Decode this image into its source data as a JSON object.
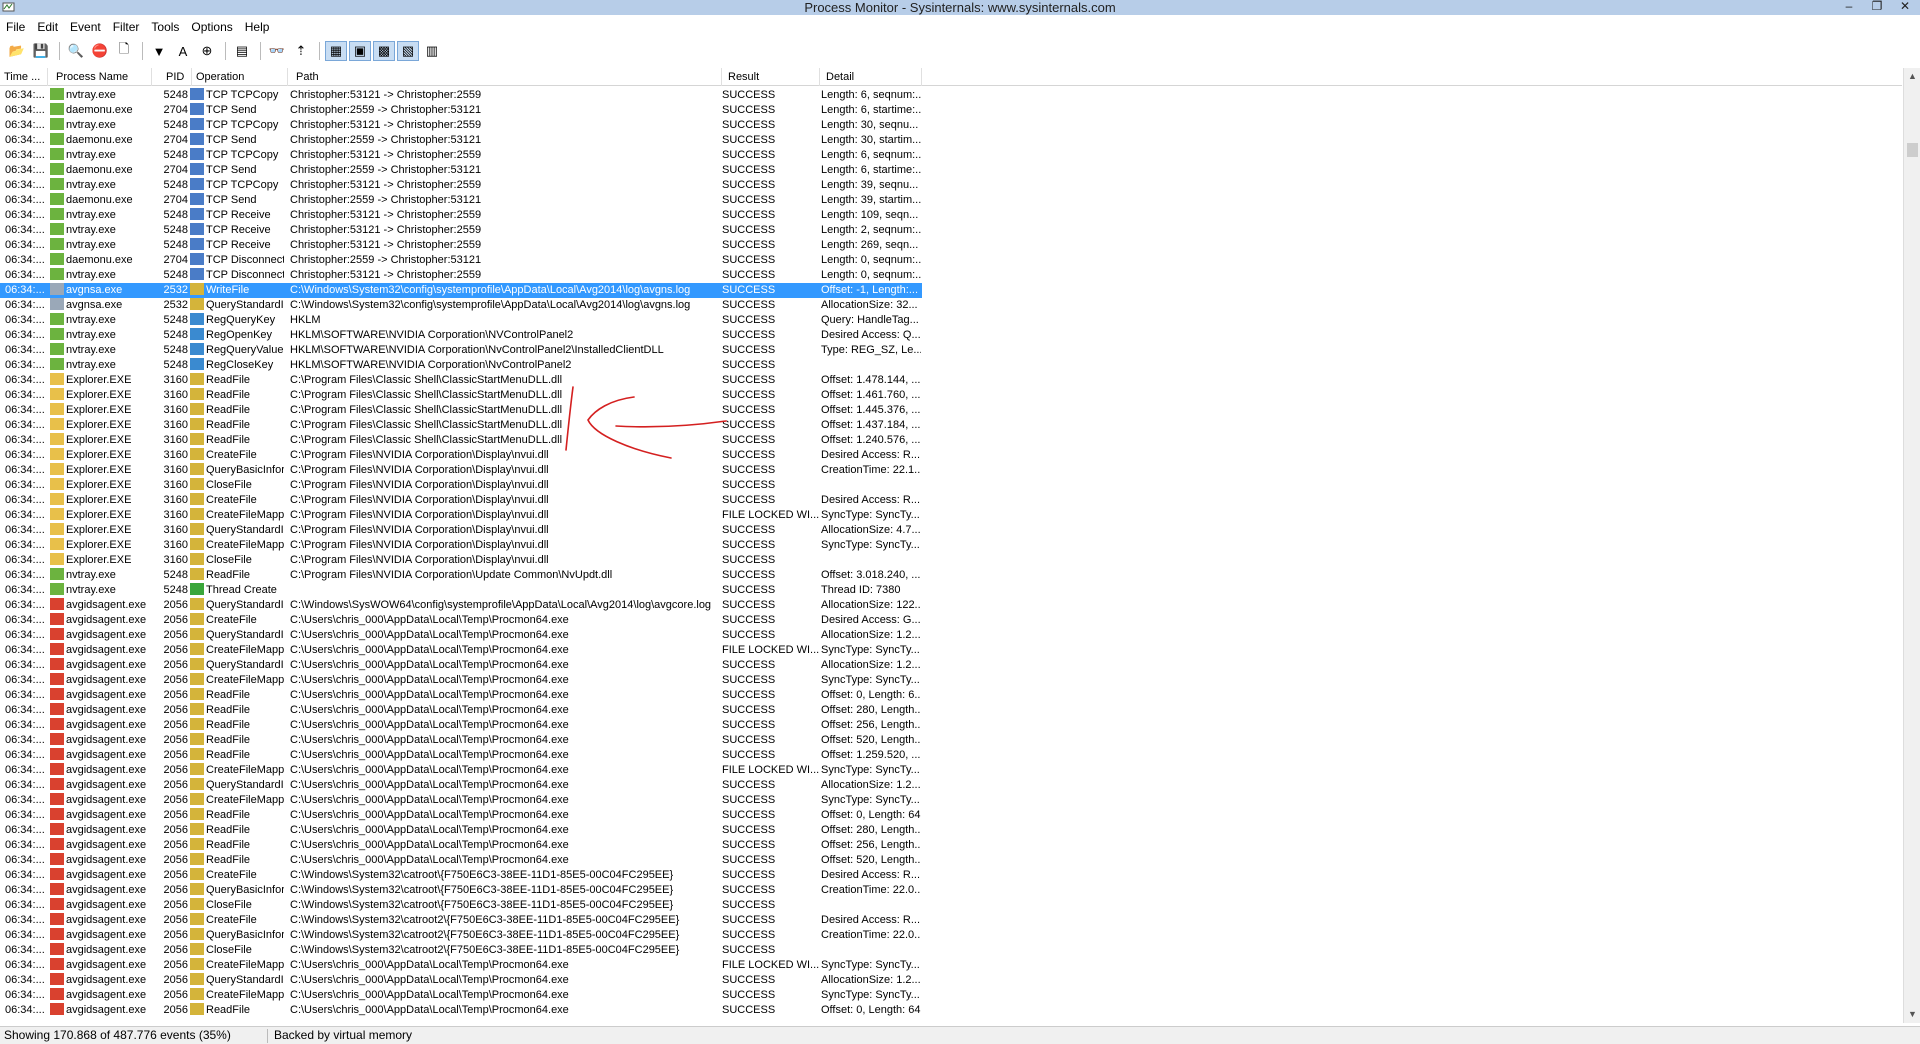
{
  "window": {
    "title": "Process Monitor - Sysinternals: www.sysinternals.com"
  },
  "menu": [
    "File",
    "Edit",
    "Event",
    "Filter",
    "Tools",
    "Options",
    "Help"
  ],
  "toolbar": {
    "buttons": [
      {
        "name": "open-icon",
        "glyph": "📂",
        "pressed": false
      },
      {
        "name": "save-icon",
        "glyph": "💾",
        "pressed": false
      },
      {
        "sep": true
      },
      {
        "name": "magnify-icon",
        "glyph": "🔍",
        "pressed": false
      },
      {
        "name": "autoscroll-icon",
        "glyph": "⛔",
        "pressed": false
      },
      {
        "name": "clear-icon",
        "glyph": "🗋",
        "pressed": false
      },
      {
        "sep": true
      },
      {
        "name": "filter-icon",
        "glyph": "▼",
        "pressed": false
      },
      {
        "name": "highlight-icon",
        "glyph": "A",
        "pressed": false
      },
      {
        "name": "include-process-icon",
        "glyph": "⊕",
        "pressed": false
      },
      {
        "sep": true
      },
      {
        "name": "process-tree-icon",
        "glyph": "▤",
        "pressed": false
      },
      {
        "sep": true
      },
      {
        "name": "find-icon",
        "glyph": "👓",
        "pressed": false
      },
      {
        "name": "jump-icon",
        "glyph": "⇡",
        "pressed": false
      },
      {
        "sep": true
      },
      {
        "name": "registry-activity-icon",
        "glyph": "▦",
        "pressed": true
      },
      {
        "name": "file-activity-icon",
        "glyph": "▣",
        "pressed": true
      },
      {
        "name": "network-activity-icon",
        "glyph": "▩",
        "pressed": true
      },
      {
        "name": "process-activity-icon",
        "glyph": "▧",
        "pressed": true
      },
      {
        "name": "profiling-activity-icon",
        "glyph": "▥",
        "pressed": false
      }
    ]
  },
  "columns": [
    "Time ...",
    "Process Name",
    "PID",
    "Operation",
    "Path",
    "Result",
    "Detail"
  ],
  "colors": {
    "selection": "#3399ff",
    "titlebar": "#b7cde8",
    "annotation": "#d42020"
  },
  "rows": [
    [
      "06:34:...",
      "nvtray.exe",
      "5248",
      "TCP TCPCopy",
      "Christopher:53121 -> Christopher:2559",
      "SUCCESS",
      "Length: 6, seqnum:..."
    ],
    [
      "06:34:...",
      "daemonu.exe",
      "2704",
      "TCP Send",
      "Christopher:2559 -> Christopher:53121",
      "SUCCESS",
      "Length: 6, startime:..."
    ],
    [
      "06:34:...",
      "nvtray.exe",
      "5248",
      "TCP TCPCopy",
      "Christopher:53121 -> Christopher:2559",
      "SUCCESS",
      "Length: 30, seqnu..."
    ],
    [
      "06:34:...",
      "daemonu.exe",
      "2704",
      "TCP Send",
      "Christopher:2559 -> Christopher:53121",
      "SUCCESS",
      "Length: 30, startim..."
    ],
    [
      "06:34:...",
      "nvtray.exe",
      "5248",
      "TCP TCPCopy",
      "Christopher:53121 -> Christopher:2559",
      "SUCCESS",
      "Length: 6, seqnum:..."
    ],
    [
      "06:34:...",
      "daemonu.exe",
      "2704",
      "TCP Send",
      "Christopher:2559 -> Christopher:53121",
      "SUCCESS",
      "Length: 6, startime:..."
    ],
    [
      "06:34:...",
      "nvtray.exe",
      "5248",
      "TCP TCPCopy",
      "Christopher:53121 -> Christopher:2559",
      "SUCCESS",
      "Length: 39, seqnu..."
    ],
    [
      "06:34:...",
      "daemonu.exe",
      "2704",
      "TCP Send",
      "Christopher:2559 -> Christopher:53121",
      "SUCCESS",
      "Length: 39, startim..."
    ],
    [
      "06:34:...",
      "nvtray.exe",
      "5248",
      "TCP Receive",
      "Christopher:53121 -> Christopher:2559",
      "SUCCESS",
      "Length: 109, seqn..."
    ],
    [
      "06:34:...",
      "nvtray.exe",
      "5248",
      "TCP Receive",
      "Christopher:53121 -> Christopher:2559",
      "SUCCESS",
      "Length: 2, seqnum:..."
    ],
    [
      "06:34:...",
      "nvtray.exe",
      "5248",
      "TCP Receive",
      "Christopher:53121 -> Christopher:2559",
      "SUCCESS",
      "Length: 269, seqn..."
    ],
    [
      "06:34:...",
      "daemonu.exe",
      "2704",
      "TCP Disconnect",
      "Christopher:2559 -> Christopher:53121",
      "SUCCESS",
      "Length: 0, seqnum:..."
    ],
    [
      "06:34:...",
      "nvtray.exe",
      "5248",
      "TCP Disconnect",
      "Christopher:53121 -> Christopher:2559",
      "SUCCESS",
      "Length: 0, seqnum:..."
    ],
    [
      "06:34:...",
      "avgnsa.exe",
      "2532",
      "WriteFile",
      "C:\\Windows\\System32\\config\\systemprofile\\AppData\\Local\\Avg2014\\log\\avgns.log",
      "SUCCESS",
      "Offset: -1, Length:..."
    ],
    [
      "06:34:...",
      "avgnsa.exe",
      "2532",
      "QueryStandardI...",
      "C:\\Windows\\System32\\config\\systemprofile\\AppData\\Local\\Avg2014\\log\\avgns.log",
      "SUCCESS",
      "AllocationSize: 32..."
    ],
    [
      "06:34:...",
      "nvtray.exe",
      "5248",
      "RegQueryKey",
      "HKLM",
      "SUCCESS",
      "Query: HandleTag..."
    ],
    [
      "06:34:...",
      "nvtray.exe",
      "5248",
      "RegOpenKey",
      "HKLM\\SOFTWARE\\NVIDIA Corporation\\NVControlPanel2",
      "SUCCESS",
      "Desired Access: Q..."
    ],
    [
      "06:34:...",
      "nvtray.exe",
      "5248",
      "RegQueryValue",
      "HKLM\\SOFTWARE\\NVIDIA Corporation\\NvControlPanel2\\InstalledClientDLL",
      "SUCCESS",
      "Type: REG_SZ, Le..."
    ],
    [
      "06:34:...",
      "nvtray.exe",
      "5248",
      "RegCloseKey",
      "HKLM\\SOFTWARE\\NVIDIA Corporation\\NvControlPanel2",
      "SUCCESS",
      ""
    ],
    [
      "06:34:...",
      "Explorer.EXE",
      "3160",
      "ReadFile",
      "C:\\Program Files\\Classic Shell\\ClassicStartMenuDLL.dll",
      "SUCCESS",
      "Offset: 1.478.144, ..."
    ],
    [
      "06:34:...",
      "Explorer.EXE",
      "3160",
      "ReadFile",
      "C:\\Program Files\\Classic Shell\\ClassicStartMenuDLL.dll",
      "SUCCESS",
      "Offset: 1.461.760, ..."
    ],
    [
      "06:34:...",
      "Explorer.EXE",
      "3160",
      "ReadFile",
      "C:\\Program Files\\Classic Shell\\ClassicStartMenuDLL.dll",
      "SUCCESS",
      "Offset: 1.445.376, ..."
    ],
    [
      "06:34:...",
      "Explorer.EXE",
      "3160",
      "ReadFile",
      "C:\\Program Files\\Classic Shell\\ClassicStartMenuDLL.dll",
      "SUCCESS",
      "Offset: 1.437.184, ..."
    ],
    [
      "06:34:...",
      "Explorer.EXE",
      "3160",
      "ReadFile",
      "C:\\Program Files\\Classic Shell\\ClassicStartMenuDLL.dll",
      "SUCCESS",
      "Offset: 1.240.576, ..."
    ],
    [
      "06:34:...",
      "Explorer.EXE",
      "3160",
      "CreateFile",
      "C:\\Program Files\\NVIDIA Corporation\\Display\\nvui.dll",
      "SUCCESS",
      "Desired Access: R..."
    ],
    [
      "06:34:...",
      "Explorer.EXE",
      "3160",
      "QueryBasicInfor...",
      "C:\\Program Files\\NVIDIA Corporation\\Display\\nvui.dll",
      "SUCCESS",
      "CreationTime: 22.1..."
    ],
    [
      "06:34:...",
      "Explorer.EXE",
      "3160",
      "CloseFile",
      "C:\\Program Files\\NVIDIA Corporation\\Display\\nvui.dll",
      "SUCCESS",
      ""
    ],
    [
      "06:34:...",
      "Explorer.EXE",
      "3160",
      "CreateFile",
      "C:\\Program Files\\NVIDIA Corporation\\Display\\nvui.dll",
      "SUCCESS",
      "Desired Access: R..."
    ],
    [
      "06:34:...",
      "Explorer.EXE",
      "3160",
      "CreateFileMapp...",
      "C:\\Program Files\\NVIDIA Corporation\\Display\\nvui.dll",
      "FILE LOCKED WI...",
      "SyncType: SyncTy..."
    ],
    [
      "06:34:...",
      "Explorer.EXE",
      "3160",
      "QueryStandardI...",
      "C:\\Program Files\\NVIDIA Corporation\\Display\\nvui.dll",
      "SUCCESS",
      "AllocationSize: 4.7..."
    ],
    [
      "06:34:...",
      "Explorer.EXE",
      "3160",
      "CreateFileMapp...",
      "C:\\Program Files\\NVIDIA Corporation\\Display\\nvui.dll",
      "SUCCESS",
      "SyncType: SyncTy..."
    ],
    [
      "06:34:...",
      "Explorer.EXE",
      "3160",
      "CloseFile",
      "C:\\Program Files\\NVIDIA Corporation\\Display\\nvui.dll",
      "SUCCESS",
      ""
    ],
    [
      "06:34:...",
      "nvtray.exe",
      "5248",
      "ReadFile",
      "C:\\Program Files\\NVIDIA Corporation\\Update Common\\NvUpdt.dll",
      "SUCCESS",
      "Offset: 3.018.240, ..."
    ],
    [
      "06:34:...",
      "nvtray.exe",
      "5248",
      "Thread Create",
      "",
      "SUCCESS",
      "Thread ID: 7380"
    ],
    [
      "06:34:...",
      "avgidsagent.exe",
      "2056",
      "QueryStandardI...",
      "C:\\Windows\\SysWOW64\\config\\systemprofile\\AppData\\Local\\Avg2014\\log\\avgcore.log",
      "SUCCESS",
      "AllocationSize: 122..."
    ],
    [
      "06:34:...",
      "avgidsagent.exe",
      "2056",
      "CreateFile",
      "C:\\Users\\chris_000\\AppData\\Local\\Temp\\Procmon64.exe",
      "SUCCESS",
      "Desired Access: G..."
    ],
    [
      "06:34:...",
      "avgidsagent.exe",
      "2056",
      "QueryStandardI...",
      "C:\\Users\\chris_000\\AppData\\Local\\Temp\\Procmon64.exe",
      "SUCCESS",
      "AllocationSize: 1.2..."
    ],
    [
      "06:34:...",
      "avgidsagent.exe",
      "2056",
      "CreateFileMapp...",
      "C:\\Users\\chris_000\\AppData\\Local\\Temp\\Procmon64.exe",
      "FILE LOCKED WI...",
      "SyncType: SyncTy..."
    ],
    [
      "06:34:...",
      "avgidsagent.exe",
      "2056",
      "QueryStandardI...",
      "C:\\Users\\chris_000\\AppData\\Local\\Temp\\Procmon64.exe",
      "SUCCESS",
      "AllocationSize: 1.2..."
    ],
    [
      "06:34:...",
      "avgidsagent.exe",
      "2056",
      "CreateFileMapp...",
      "C:\\Users\\chris_000\\AppData\\Local\\Temp\\Procmon64.exe",
      "SUCCESS",
      "SyncType: SyncTy..."
    ],
    [
      "06:34:...",
      "avgidsagent.exe",
      "2056",
      "ReadFile",
      "C:\\Users\\chris_000\\AppData\\Local\\Temp\\Procmon64.exe",
      "SUCCESS",
      "Offset: 0, Length: 6..."
    ],
    [
      "06:34:...",
      "avgidsagent.exe",
      "2056",
      "ReadFile",
      "C:\\Users\\chris_000\\AppData\\Local\\Temp\\Procmon64.exe",
      "SUCCESS",
      "Offset: 280, Length..."
    ],
    [
      "06:34:...",
      "avgidsagent.exe",
      "2056",
      "ReadFile",
      "C:\\Users\\chris_000\\AppData\\Local\\Temp\\Procmon64.exe",
      "SUCCESS",
      "Offset: 256, Length..."
    ],
    [
      "06:34:...",
      "avgidsagent.exe",
      "2056",
      "ReadFile",
      "C:\\Users\\chris_000\\AppData\\Local\\Temp\\Procmon64.exe",
      "SUCCESS",
      "Offset: 520, Length..."
    ],
    [
      "06:34:...",
      "avgidsagent.exe",
      "2056",
      "ReadFile",
      "C:\\Users\\chris_000\\AppData\\Local\\Temp\\Procmon64.exe",
      "SUCCESS",
      "Offset: 1.259.520, ..."
    ],
    [
      "06:34:...",
      "avgidsagent.exe",
      "2056",
      "CreateFileMapp...",
      "C:\\Users\\chris_000\\AppData\\Local\\Temp\\Procmon64.exe",
      "FILE LOCKED WI...",
      "SyncType: SyncTy..."
    ],
    [
      "06:34:...",
      "avgidsagent.exe",
      "2056",
      "QueryStandardI...",
      "C:\\Users\\chris_000\\AppData\\Local\\Temp\\Procmon64.exe",
      "SUCCESS",
      "AllocationSize: 1.2..."
    ],
    [
      "06:34:...",
      "avgidsagent.exe",
      "2056",
      "CreateFileMapp...",
      "C:\\Users\\chris_000\\AppData\\Local\\Temp\\Procmon64.exe",
      "SUCCESS",
      "SyncType: SyncTy..."
    ],
    [
      "06:34:...",
      "avgidsagent.exe",
      "2056",
      "ReadFile",
      "C:\\Users\\chris_000\\AppData\\Local\\Temp\\Procmon64.exe",
      "SUCCESS",
      "Offset: 0, Length: 64"
    ],
    [
      "06:34:...",
      "avgidsagent.exe",
      "2056",
      "ReadFile",
      "C:\\Users\\chris_000\\AppData\\Local\\Temp\\Procmon64.exe",
      "SUCCESS",
      "Offset: 280, Length..."
    ],
    [
      "06:34:...",
      "avgidsagent.exe",
      "2056",
      "ReadFile",
      "C:\\Users\\chris_000\\AppData\\Local\\Temp\\Procmon64.exe",
      "SUCCESS",
      "Offset: 256, Length..."
    ],
    [
      "06:34:...",
      "avgidsagent.exe",
      "2056",
      "ReadFile",
      "C:\\Users\\chris_000\\AppData\\Local\\Temp\\Procmon64.exe",
      "SUCCESS",
      "Offset: 520, Length..."
    ],
    [
      "06:34:...",
      "avgidsagent.exe",
      "2056",
      "CreateFile",
      "C:\\Windows\\System32\\catroot\\{F750E6C3-38EE-11D1-85E5-00C04FC295EE}",
      "SUCCESS",
      "Desired Access: R..."
    ],
    [
      "06:34:...",
      "avgidsagent.exe",
      "2056",
      "QueryBasicInfor...",
      "C:\\Windows\\System32\\catroot\\{F750E6C3-38EE-11D1-85E5-00C04FC295EE}",
      "SUCCESS",
      "CreationTime: 22.0..."
    ],
    [
      "06:34:...",
      "avgidsagent.exe",
      "2056",
      "CloseFile",
      "C:\\Windows\\System32\\catroot\\{F750E6C3-38EE-11D1-85E5-00C04FC295EE}",
      "SUCCESS",
      ""
    ],
    [
      "06:34:...",
      "avgidsagent.exe",
      "2056",
      "CreateFile",
      "C:\\Windows\\System32\\catroot2\\{F750E6C3-38EE-11D1-85E5-00C04FC295EE}",
      "SUCCESS",
      "Desired Access: R..."
    ],
    [
      "06:34:...",
      "avgidsagent.exe",
      "2056",
      "QueryBasicInfor...",
      "C:\\Windows\\System32\\catroot2\\{F750E6C3-38EE-11D1-85E5-00C04FC295EE}",
      "SUCCESS",
      "CreationTime: 22.0..."
    ],
    [
      "06:34:...",
      "avgidsagent.exe",
      "2056",
      "CloseFile",
      "C:\\Windows\\System32\\catroot2\\{F750E6C3-38EE-11D1-85E5-00C04FC295EE}",
      "SUCCESS",
      ""
    ],
    [
      "06:34:...",
      "avgidsagent.exe",
      "2056",
      "CreateFileMapp...",
      "C:\\Users\\chris_000\\AppData\\Local\\Temp\\Procmon64.exe",
      "FILE LOCKED WI...",
      "SyncType: SyncTy..."
    ],
    [
      "06:34:...",
      "avgidsagent.exe",
      "2056",
      "QueryStandardI...",
      "C:\\Users\\chris_000\\AppData\\Local\\Temp\\Procmon64.exe",
      "SUCCESS",
      "AllocationSize: 1.2..."
    ],
    [
      "06:34:...",
      "avgidsagent.exe",
      "2056",
      "CreateFileMapp...",
      "C:\\Users\\chris_000\\AppData\\Local\\Temp\\Procmon64.exe",
      "SUCCESS",
      "SyncType: SyncTy..."
    ],
    [
      "06:34:...",
      "avgidsagent.exe",
      "2056",
      "ReadFile",
      "C:\\Users\\chris_000\\AppData\\Local\\Temp\\Procmon64.exe",
      "SUCCESS",
      "Offset: 0, Length: 64"
    ]
  ],
  "selected_row": 13,
  "status": {
    "events": "Showing 170.868 of 487.776 events (35%)",
    "memory": "Backed by virtual memory"
  }
}
